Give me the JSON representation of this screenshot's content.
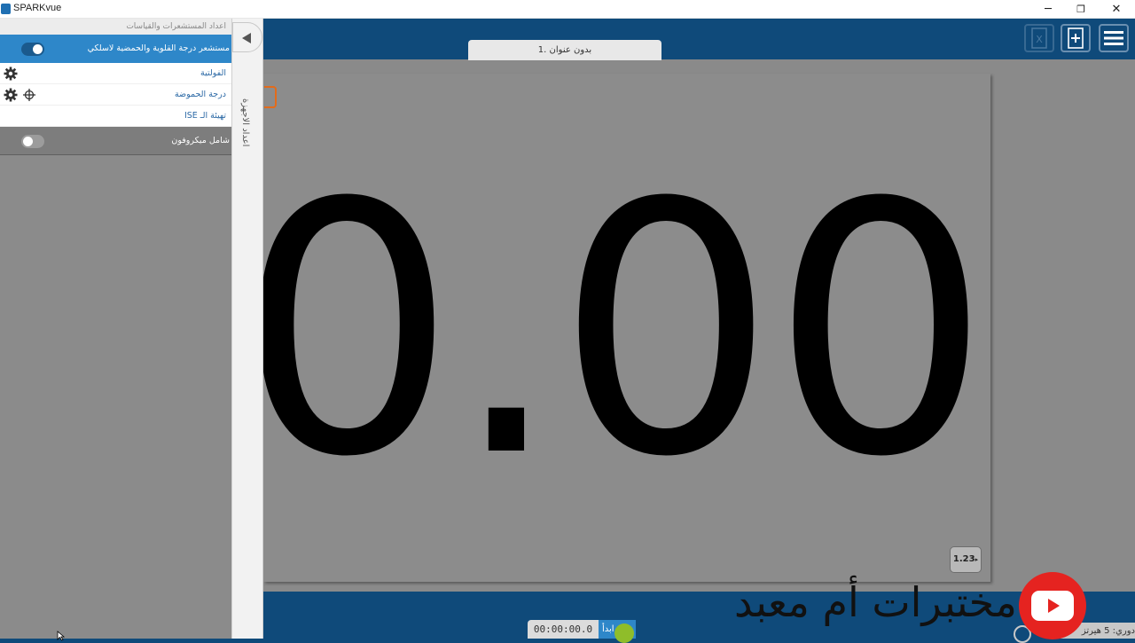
{
  "window": {
    "title": "SPARKvue",
    "minimize": "─",
    "maximize": "❐",
    "close": "✕"
  },
  "header": {
    "excel_icon": "excel-export-icon",
    "add_page_icon": "add-page-icon",
    "menu_icon": "hamburger-menu-icon"
  },
  "page": {
    "tab_title": "بدون عنوان .1",
    "display_value": "0.00",
    "format_button": "1.23"
  },
  "sidebar": {
    "header": "اعداد المستشعرات والقياسات",
    "device": "مستشعر درجة القلوية والحمضية لاسلكي",
    "device_connected": true,
    "measurements": [
      {
        "label": "الفولتية",
        "gear": true,
        "target": false
      },
      {
        "label": "درجة الحموضة",
        "gear": true,
        "target": true
      },
      {
        "label": "تهيئة الـ ISE",
        "gear": false,
        "target": false
      }
    ],
    "microphone": "شامل ميكروفون",
    "microphone_enabled": false,
    "vertical_tab": "اعداد الاجهزة"
  },
  "bottom": {
    "timer": "00:00:00.0",
    "mode": "ابدأ",
    "rate": "دوري: 5 هيرتز"
  },
  "watermark": {
    "text": "مختبرات أم معبد"
  },
  "colors": {
    "header_bg": "#0f4a7a",
    "accent_blue": "#2e87c9",
    "record_green": "#8fbd2a",
    "youtube_red": "#e52320"
  }
}
